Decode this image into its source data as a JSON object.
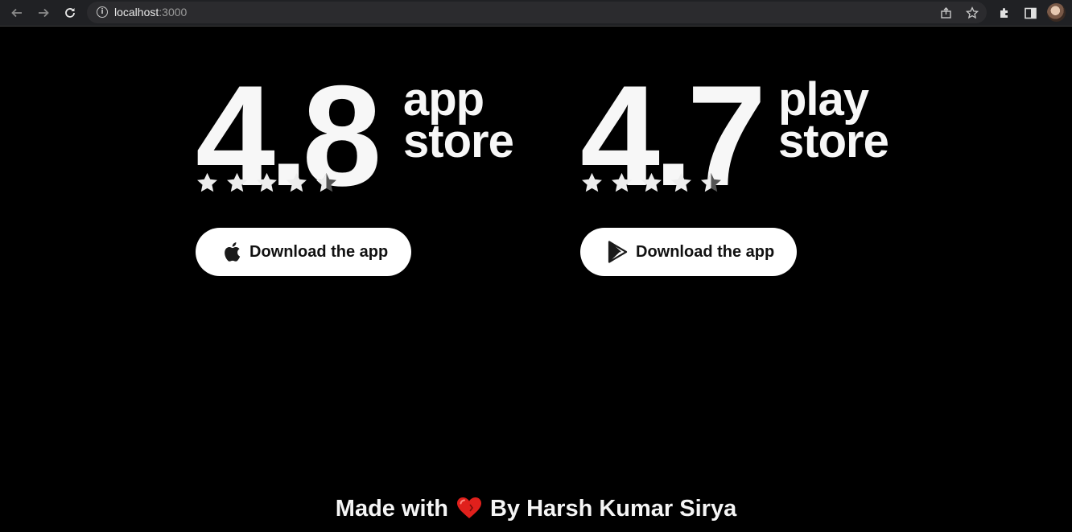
{
  "browser": {
    "url_host": "localhost",
    "url_port": ":3000",
    "icons": [
      "back-arrow-icon",
      "forward-arrow-icon",
      "reload-icon",
      "info-icon",
      "share-icon",
      "star-bookmark-icon",
      "extensions-puzzle-icon",
      "side-panel-icon",
      "profile-avatar"
    ]
  },
  "ratings": [
    {
      "score": "4.8",
      "store_line1": "app",
      "store_line2": "store",
      "stars": 4.5,
      "button_label": "Download the app",
      "button_icon": "apple-icon"
    },
    {
      "score": "4.7",
      "store_line1": "play",
      "store_line2": "store",
      "stars": 4.5,
      "button_label": "Download the app",
      "button_icon": "google-play-icon"
    }
  ],
  "footer": {
    "made_with": "Made with",
    "by": "By Harsh Kumar Sirya",
    "heart_color": "#e0201c"
  },
  "colors": {
    "background": "#000000",
    "text": "#f7f7f7",
    "button_bg": "#ffffff",
    "star_half_empty": "#555555"
  }
}
